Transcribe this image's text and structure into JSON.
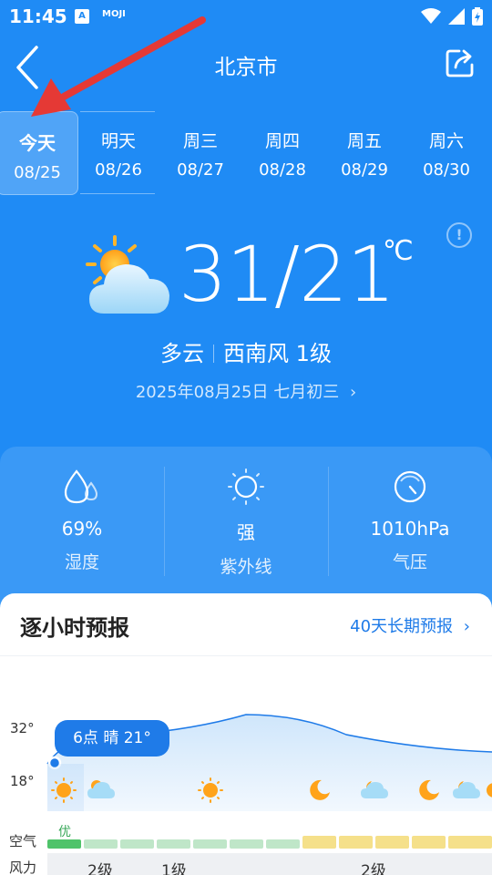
{
  "status_bar": {
    "time": "11:45",
    "app_badge_1": "A",
    "app_badge_2": "MOJI"
  },
  "header": {
    "city": "北京市",
    "back_icon": "chevron-left-icon",
    "share_icon": "share-icon"
  },
  "days": [
    {
      "name": "今天",
      "date": "08/25",
      "active": true
    },
    {
      "name": "明天",
      "date": "08/26"
    },
    {
      "name": "周三",
      "date": "08/27"
    },
    {
      "name": "周四",
      "date": "08/28"
    },
    {
      "name": "周五",
      "date": "08/29"
    },
    {
      "name": "周六",
      "date": "08/30"
    }
  ],
  "today": {
    "temperature": "31/21",
    "unit": "℃",
    "condition": "多云",
    "wind": "西南风 1级",
    "date_line": "2025年08月25日 七月初三",
    "info_icon": "!"
  },
  "stats": [
    {
      "icon": "humidity-icon",
      "value": "69%",
      "label": "湿度"
    },
    {
      "icon": "uv-sun-icon",
      "value": "强",
      "label": "紫外线"
    },
    {
      "icon": "pressure-gauge-icon",
      "value": "1010hPa",
      "label": "气压"
    }
  ],
  "hourly": {
    "title": "逐小时预报",
    "long_forecast_link": "40天长期预报",
    "y_top": "32°",
    "y_bottom": "18°",
    "bubble": "6点 晴 21°",
    "air_label": "空气",
    "wind_label": "风力",
    "aqi_first": "优",
    "winds": [
      "2级",
      "1级",
      "2级"
    ]
  },
  "colors": {
    "background": "#1f8bf5",
    "accent": "#1f7be8",
    "aqi_good": "#4fc36a",
    "aqi_moderate": "#f5e08a"
  }
}
